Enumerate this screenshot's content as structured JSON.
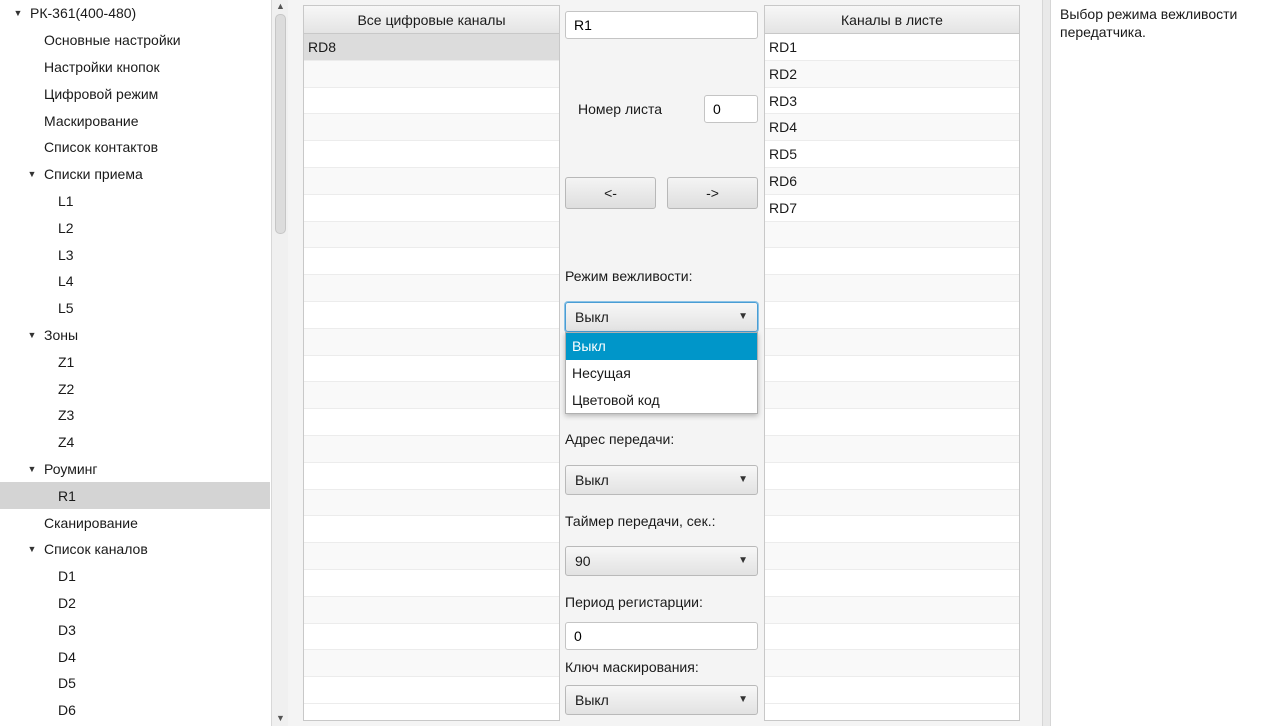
{
  "tree": {
    "items": [
      {
        "label": "РК-361(400-480)",
        "expanded": true
      },
      {
        "label": "Основные настройки"
      },
      {
        "label": "Настройки кнопок"
      },
      {
        "label": "Цифровой режим"
      },
      {
        "label": "Маскирование"
      },
      {
        "label": "Список контактов"
      },
      {
        "label": "Списки приема",
        "expanded": true
      },
      {
        "label": "L1"
      },
      {
        "label": "L2"
      },
      {
        "label": "L3"
      },
      {
        "label": "L4"
      },
      {
        "label": "L5"
      },
      {
        "label": "Зоны",
        "expanded": true
      },
      {
        "label": "Z1"
      },
      {
        "label": "Z2"
      },
      {
        "label": "Z3"
      },
      {
        "label": "Z4"
      },
      {
        "label": "Роуминг",
        "expanded": true
      },
      {
        "label": "R1",
        "selected": true
      },
      {
        "label": "Сканирование"
      },
      {
        "label": "Список каналов",
        "expanded": true
      },
      {
        "label": "D1"
      },
      {
        "label": "D2"
      },
      {
        "label": "D3"
      },
      {
        "label": "D4"
      },
      {
        "label": "D5"
      },
      {
        "label": "D6"
      }
    ]
  },
  "all_channels": {
    "header": "Все цифровые каналы",
    "rows": [
      "RD8"
    ]
  },
  "list_channels": {
    "header": "Каналы в листе",
    "rows": [
      "RD1",
      "RD2",
      "RD3",
      "RD4",
      "RD5",
      "RD6",
      "RD7"
    ]
  },
  "form": {
    "name_value": "R1",
    "sheet_label": "Номер листа",
    "sheet_value": "0",
    "move_left_label": "<-",
    "move_right_label": "->",
    "courtesy_label": "Режим вежливости:",
    "courtesy_value": "Выкл",
    "courtesy_options": [
      "Выкл",
      "Несущая",
      "Цветовой код"
    ],
    "address_label": "Адрес передачи:",
    "address_value": "Выкл",
    "timer_label": "Таймер передачи, сек.:",
    "timer_value": "90",
    "reg_label": "Период регистарции:",
    "reg_value": "0",
    "mask_label": "Ключ маскирования:",
    "mask_value": "Выкл"
  },
  "help": {
    "text": "Выбор режима вежливости передатчика."
  },
  "colors": {
    "accent": "#0096c9",
    "selection": "#d4d4d4"
  }
}
